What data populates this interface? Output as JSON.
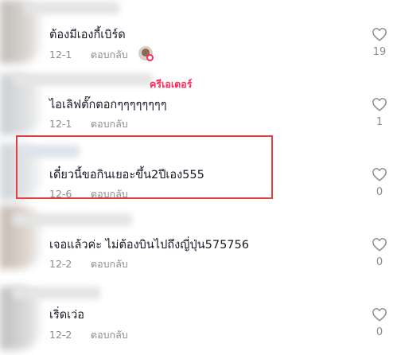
{
  "comments": [
    {
      "text": "ต้องมีเองกี้เบิร์ด",
      "date": "12-1",
      "reply_label": "ตอบกลับ",
      "likes": "19",
      "creator_liked": true
    },
    {
      "text": "ไอเลิฟตั๊กตอกๆๆๆๆๆๆๆๆ",
      "date": "12-1",
      "reply_label": "ตอบกลับ",
      "likes": "1",
      "creator_tag": "ครีเอเตอร์"
    },
    {
      "text": "เดี๋ยวนี้ขอกินเยอะขึ้น2ปีเอง555",
      "date": "12-6",
      "reply_label": "ตอบกลับ",
      "likes": "0"
    },
    {
      "text": "เจอแล้วค่ะ ไม่ต้องบินไปถึงญี่ปุ่น575756",
      "date": "12-2",
      "reply_label": "ตอบกลับ",
      "likes": "0"
    },
    {
      "text": "เริ่ดเว่อ",
      "date": "12-2",
      "reply_label": "ตอบกลับ",
      "likes": "0"
    }
  ],
  "colors": {
    "accent_red": "#fe2c55",
    "highlight_border": "#e0413f",
    "text_primary": "#161823",
    "text_secondary": "#8a8b91"
  },
  "icons": [
    "heart-outline-icon",
    "creator-avatar"
  ]
}
